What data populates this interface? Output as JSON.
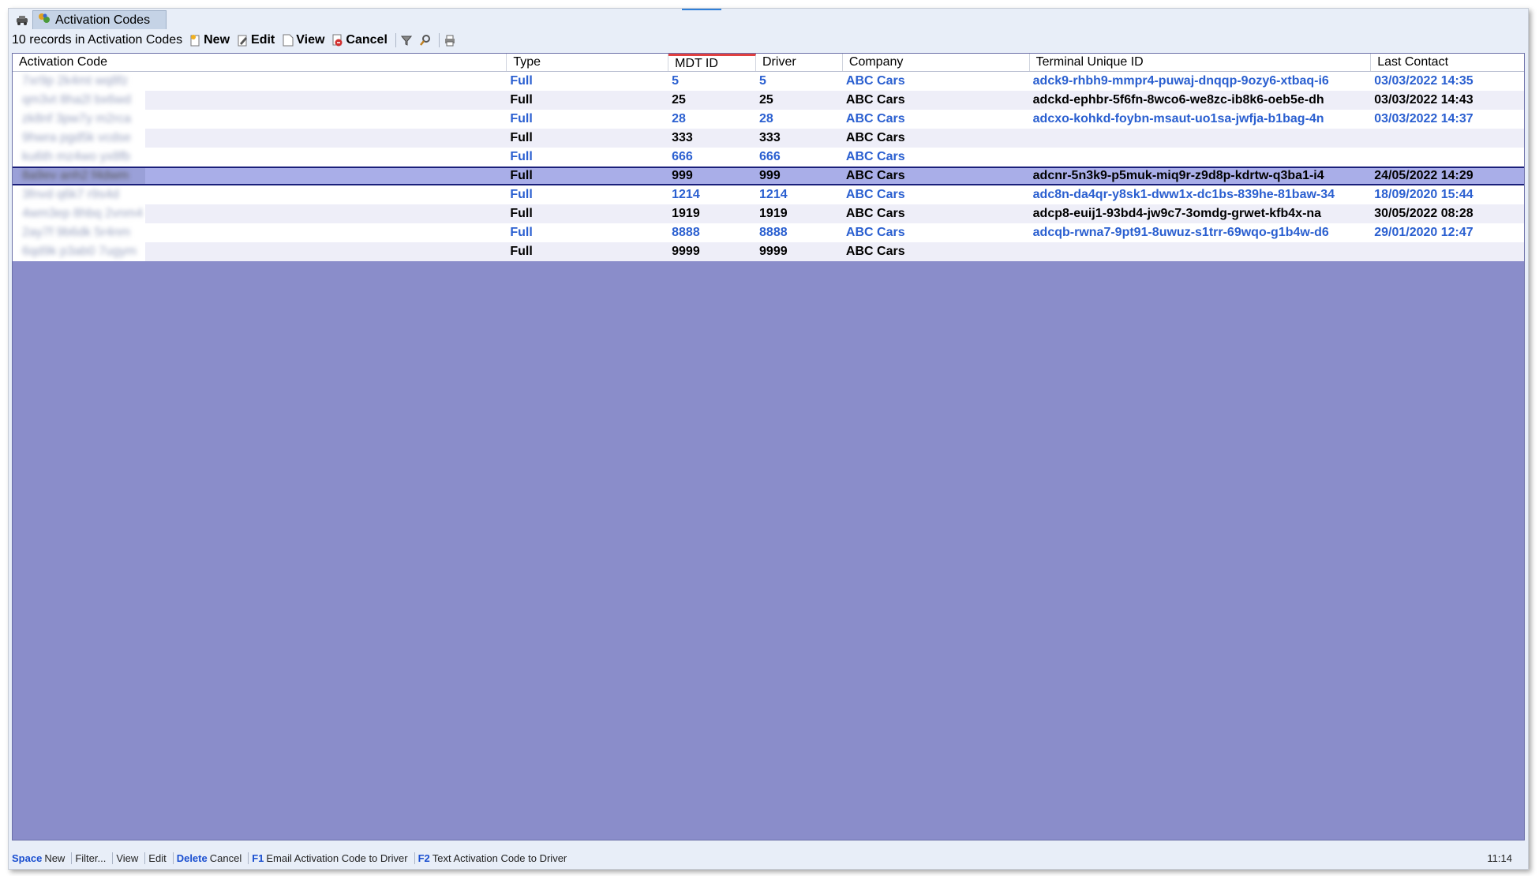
{
  "tab": {
    "title": "Activation Codes"
  },
  "toolbar": {
    "record_count": "10 records in Activation Codes",
    "new_label": "New",
    "edit_label": "Edit",
    "view_label": "View",
    "cancel_label": "Cancel"
  },
  "columns": [
    "Activation Code",
    "Type",
    "MDT ID",
    "Driver",
    "Company",
    "Terminal Unique ID",
    "Last Contact"
  ],
  "rows": [
    {
      "code": "7xr9p 2k4mt wq8fz",
      "type": "Full",
      "mdt": "5",
      "driver": "5",
      "company": "ABC Cars",
      "terminal": "adck9-rhbh9-mmpr4-puwaj-dnqqp-9ozy6-xtbaq-i6",
      "last": "03/03/2022 14:35"
    },
    {
      "code": "qm3vt 8ha2l bx6wd",
      "type": "Full",
      "mdt": "25",
      "driver": "25",
      "company": "ABC Cars",
      "terminal": "adckd-ephbr-5f6fn-8wco6-we8zc-ib8k6-oeb5e-dh",
      "last": "03/03/2022 14:43"
    },
    {
      "code": "zk8nf 3pw7y m2rca",
      "type": "Full",
      "mdt": "28",
      "driver": "28",
      "company": "ABC Cars",
      "terminal": "adcxo-kohkd-foybn-msaut-uo1sa-jwfja-b1bag-4n",
      "last": "03/03/2022 14:37"
    },
    {
      "code": "9hwra pgd5k vcdse",
      "type": "Full",
      "mdt": "333",
      "driver": "333",
      "company": "ABC Cars",
      "terminal": "",
      "last": ""
    },
    {
      "code": "ku6th mz4wo yx8fb",
      "type": "Full",
      "mdt": "666",
      "driver": "666",
      "company": "ABC Cars",
      "terminal": "",
      "last": ""
    },
    {
      "code": "8a9ev anh2 f4dwm",
      "type": "Full",
      "mdt": "999",
      "driver": "999",
      "company": "ABC Cars",
      "terminal": "adcnr-5n3k9-p5muk-miq9r-z9d8p-kdrtw-q3ba1-i4",
      "last": "24/05/2022 14:29"
    },
    {
      "code": "3fnvd q6k7 r9s4d",
      "type": "Full",
      "mdt": "1214",
      "driver": "1214",
      "company": "ABC Cars",
      "terminal": "adc8n-da4qr-y8sk1-dww1x-dc1bs-839he-81baw-34",
      "last": "18/09/2020 15:44"
    },
    {
      "code": "4wm3ep 8hbq 2vnm4",
      "type": "Full",
      "mdt": "1919",
      "driver": "1919",
      "company": "ABC Cars",
      "terminal": "adcp8-euij1-93bd4-jw9c7-3omdg-grwet-kfb4x-na",
      "last": "30/05/2022 08:28"
    },
    {
      "code": "2ay7f 9b6dk 5r4nm",
      "type": "Full",
      "mdt": "8888",
      "driver": "8888",
      "company": "ABC Cars",
      "terminal": "adcqb-rwna7-9pt91-8uwuz-s1trr-69wqo-g1b4w-d6",
      "last": "29/01/2020 12:47"
    },
    {
      "code": "6qd9k p3ab0 7ugym",
      "type": "Full",
      "mdt": "9999",
      "driver": "9999",
      "company": "ABC Cars",
      "terminal": "",
      "last": ""
    }
  ],
  "statusbar": {
    "items": [
      {
        "key": "Space",
        "text": "New"
      },
      {
        "key": "",
        "text": "Filter..."
      },
      {
        "key": "",
        "text": "View"
      },
      {
        "key": "",
        "text": "Edit"
      },
      {
        "key": "Delete",
        "text": "Cancel"
      },
      {
        "key": "F1",
        "text": "Email Activation Code to Driver"
      },
      {
        "key": "F2",
        "text": "Text Activation Code to Driver"
      }
    ],
    "clock": "11:14"
  },
  "colors": {
    "link_blue": "#2a5fd0",
    "grid_bg": "#8a8dca",
    "selected_row": "#a9aee8"
  }
}
